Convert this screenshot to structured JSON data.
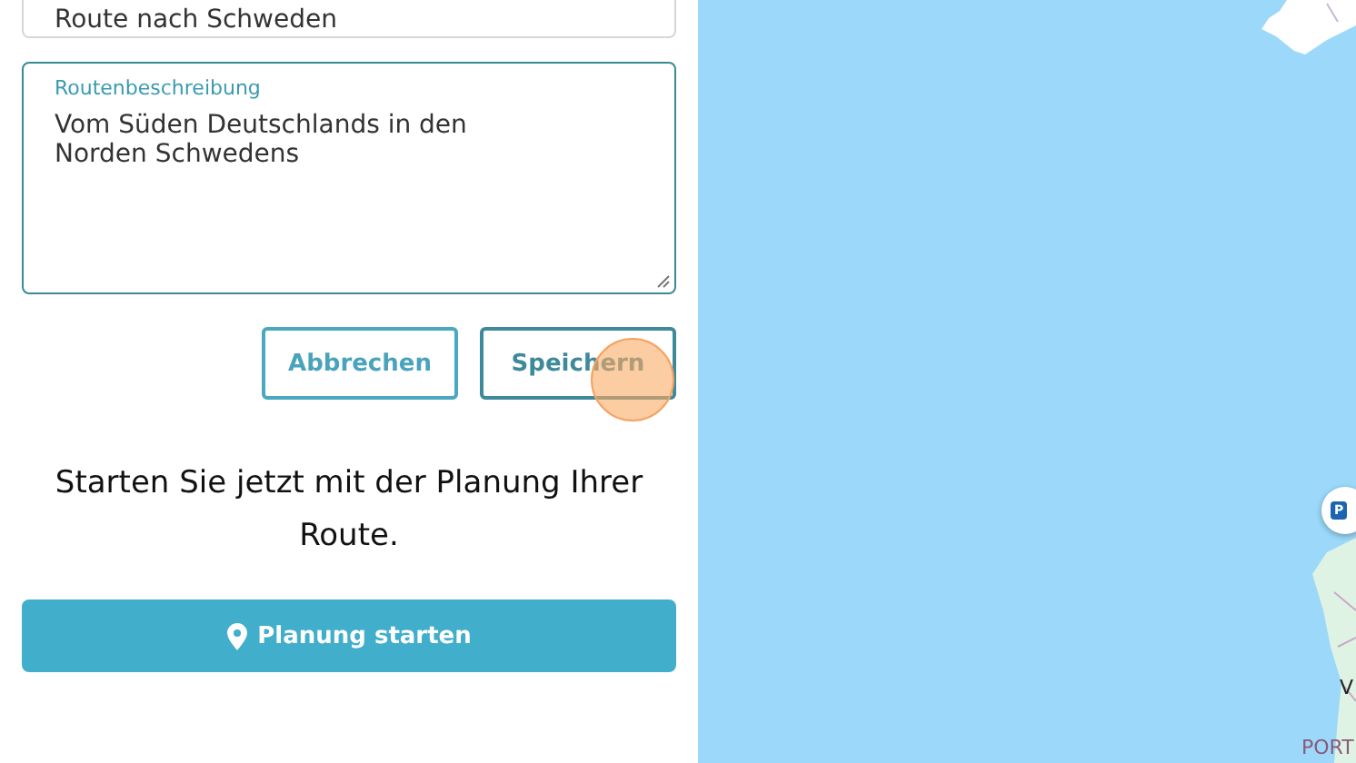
{
  "form": {
    "route_name": {
      "value": "Route nach Schweden"
    },
    "description": {
      "label": "Routenbeschreibung",
      "value": "Vom Süden Deutschlands in den Norden Schwedens",
      "focused": true
    },
    "buttons": [
      {
        "label": "Abbrechen",
        "hovered": false
      },
      {
        "label": "Speichern",
        "hovered": true
      }
    ],
    "prompt": "Starten Sie jetzt mit der Planung Ihrer Route.",
    "start_button": {
      "label": "Planung starten"
    }
  },
  "map": {
    "marker": {
      "label": "P"
    },
    "labels": [
      {
        "text": "V",
        "kind": "city"
      },
      {
        "text": "PORT",
        "kind": "country"
      }
    ]
  }
}
